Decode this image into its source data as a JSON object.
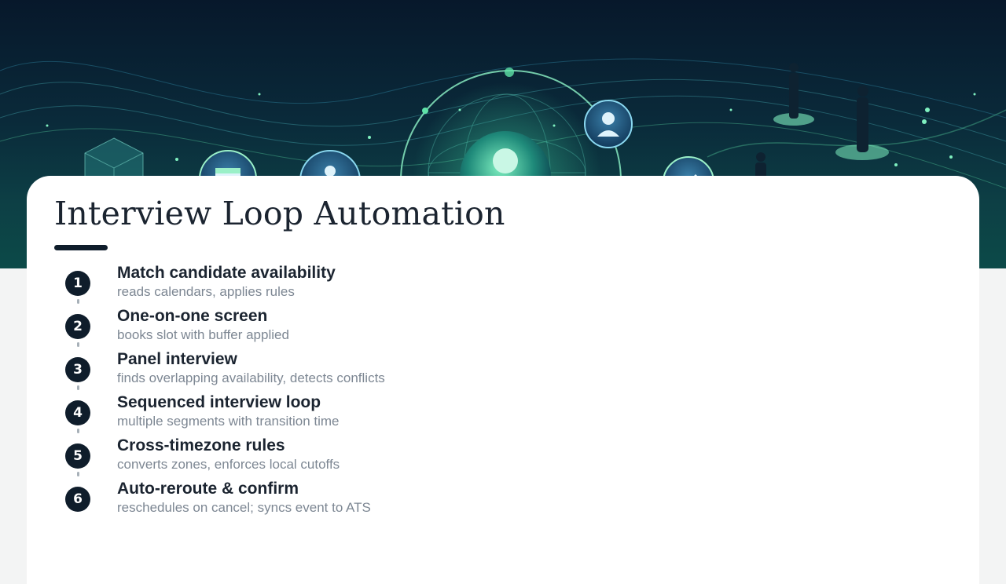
{
  "slide": {
    "title": "Interview Loop Automation",
    "steps": [
      {
        "number": "1",
        "title": "Match candidate availability",
        "description": "reads calendars, applies rules"
      },
      {
        "number": "2",
        "title": "One-on-one screen",
        "description": "books slot with buffer applied"
      },
      {
        "number": "3",
        "title": "Panel interview",
        "description": "finds overlapping availability, detects conflicts"
      },
      {
        "number": "4",
        "title": "Sequenced interview loop",
        "description": "multiple segments with transition time"
      },
      {
        "number": "5",
        "title": "Cross-timezone rules",
        "description": "converts zones, enforces local cutoffs"
      },
      {
        "number": "6",
        "title": "Auto-reroute & confirm",
        "description": "reschedules on cancel; syncs event to ATS"
      }
    ]
  },
  "colors": {
    "hero_dark": "#07182b",
    "hero_teal": "#0d3f45",
    "glow_green": "#5fe3a8",
    "badge": "#0f1d2b",
    "title_text": "#1b2430",
    "description_text": "#7d8793"
  },
  "icons": {
    "hero_nodes": [
      "calendar-icon",
      "person-icon",
      "person-icon",
      "globe-icon",
      "checkmark-icon"
    ],
    "hero_figures": [
      "standing-person-figure",
      "standing-person-figure",
      "standing-person-figure"
    ],
    "hero_shapes": [
      "cube-icon"
    ]
  }
}
